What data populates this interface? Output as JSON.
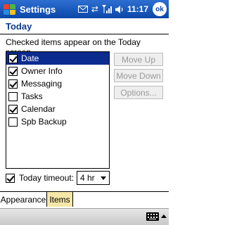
{
  "titlebar": {
    "app_title": "Settings",
    "clock": "11:17",
    "ok_label": "ok",
    "icons": [
      "windows-start-icon",
      "mail-icon",
      "sync-icon",
      "signal-icon",
      "volume-icon"
    ]
  },
  "header": {
    "title": "Today"
  },
  "instructions": "Checked items appear on the Today screen.",
  "items": [
    {
      "label": "Date",
      "checked": true,
      "selected": true
    },
    {
      "label": "Owner Info",
      "checked": true,
      "selected": false
    },
    {
      "label": "Messaging",
      "checked": true,
      "selected": false
    },
    {
      "label": "Tasks",
      "checked": false,
      "selected": false
    },
    {
      "label": "Calendar",
      "checked": true,
      "selected": false
    },
    {
      "label": "Spb Backup",
      "checked": false,
      "selected": false
    }
  ],
  "buttons": {
    "move_up": "Move Up",
    "move_down": "Move Down",
    "options": "Options..."
  },
  "timeout": {
    "label": "Today timeout:",
    "checked": true,
    "value": "4 hr"
  },
  "tabs": [
    {
      "label": "Appearance",
      "active": false
    },
    {
      "label": "Items",
      "active": true
    }
  ],
  "colors": {
    "titlebar": "#0b47a8",
    "header_text": "#0b3c8c",
    "selection": "#0b2b8f",
    "active_tab": "#f4e7a8"
  }
}
